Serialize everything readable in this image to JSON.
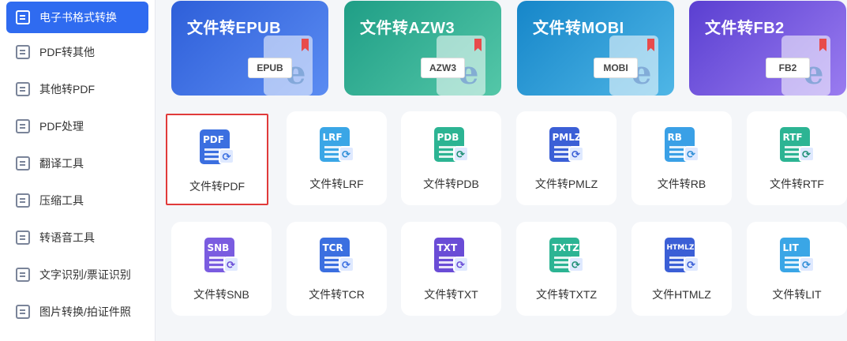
{
  "sidebar": {
    "items": [
      {
        "label": "电子书格式转换",
        "active": true,
        "icon": "book-convert-icon"
      },
      {
        "label": "PDF转其他",
        "active": false,
        "icon": "pdf-icon"
      },
      {
        "label": "其他转PDF",
        "active": false,
        "icon": "to-pdf-icon"
      },
      {
        "label": "PDF处理",
        "active": false,
        "icon": "pdf-edit-icon"
      },
      {
        "label": "翻译工具",
        "active": false,
        "icon": "translate-icon"
      },
      {
        "label": "压缩工具",
        "active": false,
        "icon": "compress-icon"
      },
      {
        "label": "转语音工具",
        "active": false,
        "icon": "audio-icon"
      },
      {
        "label": "文字识别/票证识别",
        "active": false,
        "icon": "ocr-icon"
      },
      {
        "label": "图片转换/拍证件照",
        "active": false,
        "icon": "image-icon"
      }
    ]
  },
  "banners": [
    {
      "title": "文件转EPUB",
      "badge": "EPUB",
      "bookmark_letter": "e",
      "color_from": "#2e5fd9",
      "color_to": "#5b8cf2"
    },
    {
      "title": "文件转AZW3",
      "badge": "AZW3",
      "bookmark_letter": "e",
      "color_from": "#1f9e86",
      "color_to": "#54c7a8"
    },
    {
      "title": "文件转MOBI",
      "badge": "MOBI",
      "bookmark_letter": "e",
      "color_from": "#1686c9",
      "color_to": "#4fb6e6"
    },
    {
      "title": "文件转FB2",
      "badge": "FB2",
      "bookmark_letter": "e",
      "color_from": "#5a3fd1",
      "color_to": "#9a7cf0"
    }
  ],
  "tiles": [
    {
      "label": "文件转PDF",
      "ext": "PDF",
      "color": "#3b6fe0",
      "sync_color": "#3b6fe0",
      "selected": true
    },
    {
      "label": "文件转LRF",
      "ext": "LRF",
      "color": "#3aa6e6",
      "sync_color": "#2f8ed6",
      "selected": false
    },
    {
      "label": "文件转PDB",
      "ext": "PDB",
      "color": "#2cb493",
      "sync_color": "#1e8f74",
      "selected": false
    },
    {
      "label": "文件转PMLZ",
      "ext": "PMLZ",
      "color": "#3b5fd6",
      "sync_color": "#3b5fd6",
      "selected": false
    },
    {
      "label": "文件转RB",
      "ext": "RB",
      "color": "#3aa0e6",
      "sync_color": "#2f8ed6",
      "selected": false
    },
    {
      "label": "文件转RTF",
      "ext": "RTF",
      "color": "#2cb493",
      "sync_color": "#1e8f74",
      "selected": false
    },
    {
      "label": "文件转SNB",
      "ext": "SNB",
      "color": "#7a5ce0",
      "sync_color": "#6a4cd6",
      "selected": false
    },
    {
      "label": "文件转TCR",
      "ext": "TCR",
      "color": "#3b6fe0",
      "sync_color": "#3b6fe0",
      "selected": false
    },
    {
      "label": "文件转TXT",
      "ext": "TXT",
      "color": "#6a4cd6",
      "sync_color": "#6a4cd6",
      "selected": false
    },
    {
      "label": "文件转TXTZ",
      "ext": "TXTZ",
      "color": "#2cb493",
      "sync_color": "#1e8f74",
      "selected": false
    },
    {
      "label": "文件HTMLZ",
      "ext": "HTMLZ",
      "color": "#3b5fd6",
      "sync_color": "#3b5fd6",
      "selected": false
    },
    {
      "label": "文件转LIT",
      "ext": "LIT",
      "color": "#3aa6e6",
      "sync_color": "#2f8ed6",
      "selected": false
    }
  ],
  "sync_glyph": "⟳"
}
